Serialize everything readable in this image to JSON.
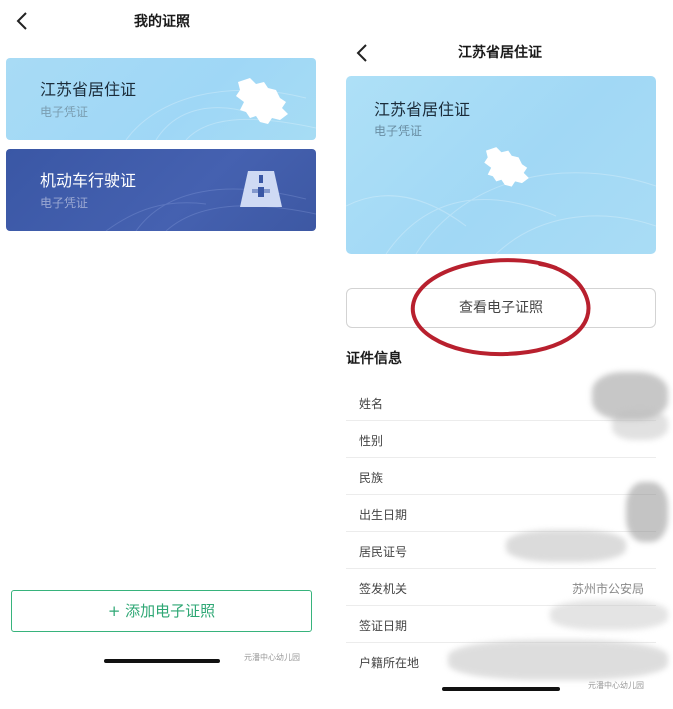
{
  "left_screen": {
    "title": "我的证照",
    "cards": [
      {
        "title": "江苏省居住证",
        "subtitle": "电子凭证",
        "icon": "jiangsu-map-icon"
      },
      {
        "title": "机动车行驶证",
        "subtitle": "电子凭证",
        "icon": "road-icon"
      }
    ],
    "add_button": "+ 添加电子证照",
    "watermark": "元潘中心幼儿园"
  },
  "right_screen": {
    "title": "江苏省居住证",
    "card": {
      "title": "江苏省居住证",
      "subtitle": "电子凭证",
      "icon": "jiangsu-map-icon"
    },
    "view_button": "查看电子证照",
    "section_title": "证件信息",
    "fields": [
      {
        "label": "姓名",
        "value": ""
      },
      {
        "label": "性别",
        "value": ""
      },
      {
        "label": "民族",
        "value": ""
      },
      {
        "label": "出生日期",
        "value": ""
      },
      {
        "label": "居民证号",
        "value": ""
      },
      {
        "label": "签发机关",
        "value": "苏州市公安局"
      },
      {
        "label": "签证日期",
        "value": ""
      },
      {
        "label": "户籍所在地",
        "value": ""
      }
    ],
    "watermark": "元潘中心幼儿园"
  },
  "colors": {
    "card_light_blue": "#a8dbf5",
    "card_dark_blue": "#3a57a5",
    "add_green": "#37b37c",
    "annotation_red": "#b8202e"
  }
}
